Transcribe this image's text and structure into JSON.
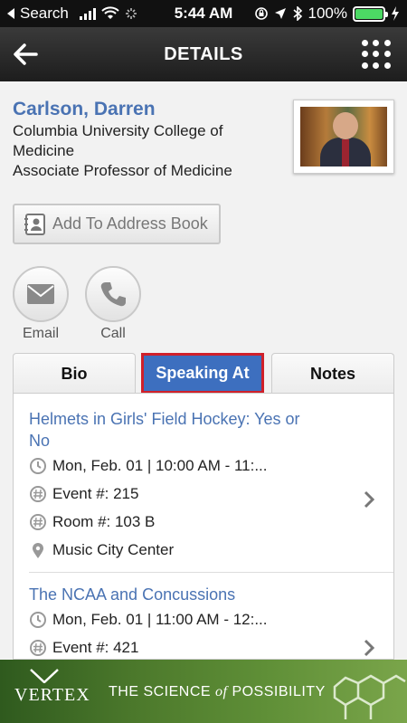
{
  "status_bar": {
    "carrier": "Search",
    "time": "5:44 AM",
    "battery": "100%"
  },
  "nav": {
    "title": "DETAILS"
  },
  "profile": {
    "name": "Carlson, Darren",
    "organization": "Columbia University College of Medicine",
    "position": "Associate Professor of Medicine",
    "add_to_address_book": "Add To Address Book"
  },
  "actions": {
    "email": "Email",
    "call": "Call"
  },
  "tabs": [
    {
      "label": "Bio",
      "active": false
    },
    {
      "label": "Speaking At",
      "active": true
    },
    {
      "label": "Notes",
      "active": false
    }
  ],
  "sessions": [
    {
      "title": "Helmets in Girls' Field Hockey: Yes or No",
      "datetime": "Mon, Feb. 01 | 10:00 AM - 11:...",
      "event": "Event #: 215",
      "room": "Room #: 103 B",
      "location": "Music City Center"
    },
    {
      "title": "The NCAA and Concussions",
      "datetime": "Mon, Feb. 01 | 11:00 AM - 12:...",
      "event": "Event #: 421"
    }
  ],
  "footer": {
    "logo": "VERTEX",
    "tagline_pre": "THE SCIENCE",
    "tagline_of": "of",
    "tagline_post": "POSSIBILITY"
  },
  "colors": {
    "accent": "#4a73b3",
    "active_tab": "#3d6fbf",
    "highlight_border": "#d0202a",
    "battery": "#4cd964"
  }
}
